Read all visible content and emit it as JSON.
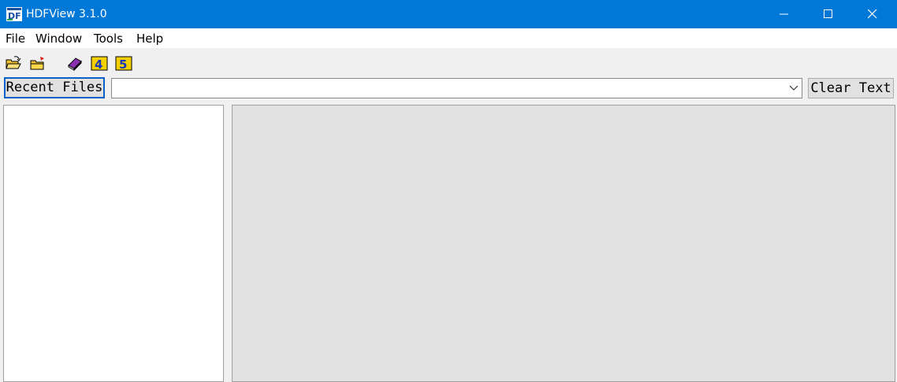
{
  "window": {
    "title": "HDFView 3.1.0",
    "titlebar_color": "#0078d7",
    "app_icon": "hdf-logo-icon",
    "controls": [
      "minimize-icon",
      "maximize-icon",
      "close-icon"
    ]
  },
  "menu": {
    "items": [
      {
        "label": "File"
      },
      {
        "label": "Window"
      },
      {
        "label": "Tools"
      },
      {
        "label": "Help"
      }
    ]
  },
  "toolbar": {
    "icons": [
      "open-folder-icon",
      "open-readonly-folder-icon",
      "users-guide-book-icon",
      "hdf4-library-icon",
      "hdf5-library-icon"
    ]
  },
  "recent": {
    "button_label": "Recent Files",
    "input_value": "",
    "clear_label": "Clear Text"
  }
}
